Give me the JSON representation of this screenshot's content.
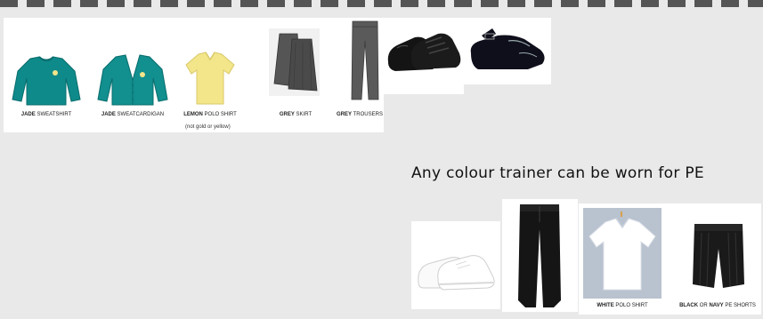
{
  "colors": {
    "jade": "#0f8a8a",
    "lemon": "#f2e58a",
    "grey": "#5a5a5a",
    "black": "#151515",
    "page_bg": "#e9e9e9"
  },
  "uniform": {
    "items": [
      {
        "strong": "JADE",
        "rest": " SWEATSHIRT"
      },
      {
        "strong": "JADE",
        "rest": " SWEATCARDIGAN"
      },
      {
        "strong": "LEMON",
        "rest": " POLO SHIRT"
      },
      {
        "strong": "GREY",
        "rest": " SKIRT"
      },
      {
        "strong": "GREY",
        "rest": " TROUSERS"
      }
    ],
    "polo_note": "(not gold or yellow)"
  },
  "pe": {
    "heading": "Any colour trainer can be worn for PE",
    "items": [
      {
        "strong": "WHITE",
        "rest": " POLO SHIRT"
      },
      {
        "strong": "BLACK",
        "middle": " OR ",
        "strong2": "NAVY",
        "rest": " PE SHORTS"
      }
    ]
  }
}
